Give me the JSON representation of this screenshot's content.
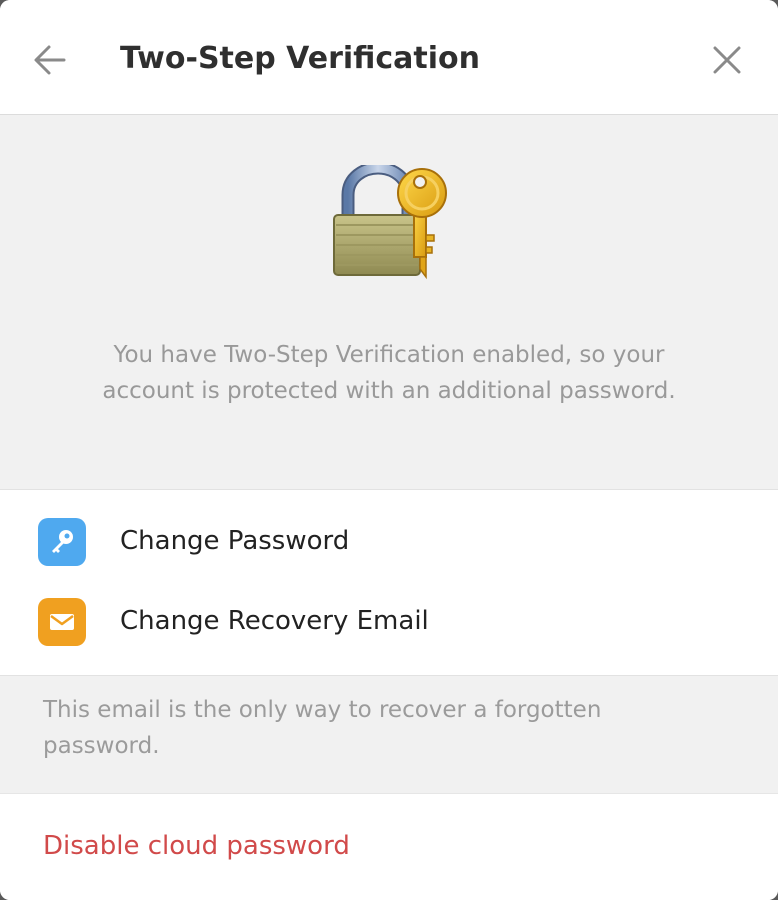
{
  "header": {
    "title": "Two-Step Verification",
    "back_icon": "arrow-left-icon",
    "close_icon": "close-icon"
  },
  "hero": {
    "illustration": "padlock-with-key-icon",
    "text": "You have Two-Step Verification enabled, so your account is protected with an additional password."
  },
  "menu": {
    "items": [
      {
        "label": "Change Password",
        "icon": "key-icon",
        "icon_color": "#4fa9ef"
      },
      {
        "label": "Change Recovery Email",
        "icon": "envelope-icon",
        "icon_color": "#f0a020"
      }
    ]
  },
  "note": {
    "text": "This email is the only way to recover a forgotten password."
  },
  "footer": {
    "disable_label": "Disable cloud password",
    "danger_color": "#d14a4a"
  }
}
